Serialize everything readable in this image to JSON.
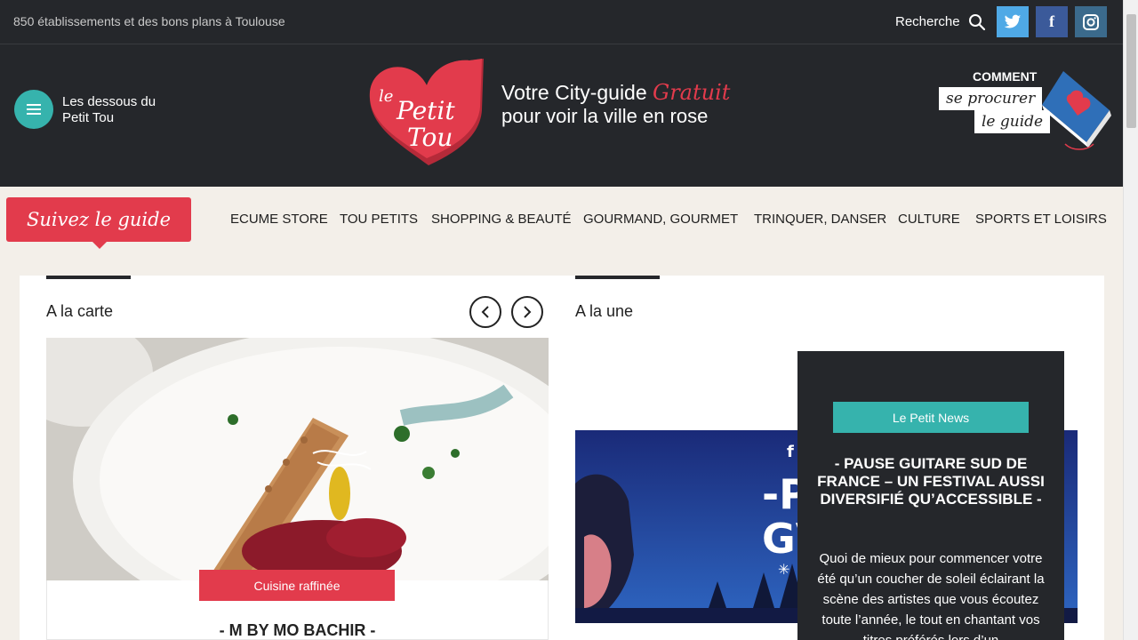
{
  "topbar": {
    "tagline": "850 établissements et des bons plans à Toulouse",
    "search_label": "Recherche",
    "social": [
      "twitter-icon",
      "facebook-icon",
      "instagram-icon"
    ]
  },
  "header": {
    "menu_label": "Les dessous du Petit Tou",
    "logo_text": [
      "le",
      "Petit",
      "Tou"
    ],
    "slogan_prefix": "Votre City-guide",
    "slogan_highlight": "Gratuit",
    "slogan_line2": "pour voir la ville en rose",
    "promo_top": "COMMENT",
    "promo_line1": "se procurer",
    "promo_line2": "le guide"
  },
  "nav": {
    "follow_label": "Suivez le guide",
    "items": [
      "ECUME STORE",
      "TOU PETITS",
      "SHOPPING & BEAUTÉ",
      "GOURMAND, GOURMET",
      "TRINQUER, DANSER",
      "CULTURE",
      "SPORTS ET LOISIRS"
    ]
  },
  "carte": {
    "title": "A la carte",
    "category": "Cuisine raffinée",
    "card_title": "- M BY MO BACHIR -"
  },
  "une": {
    "title": "A la une",
    "badge": "Le Petit News",
    "headline": "- PAUSE GUITARE SUD DE FRANCE – UN FESTIVAL AUSSI DIVERSIFIÉ QU’ACCESSIBLE -",
    "excerpt": "Quoi de mieux pour commencer votre été qu’un coucher de soleil éclairant la scène des artistes que vous écoutez toute l’année, le tout en chantant vos titres préférés lors d’un"
  },
  "colors": {
    "dark": "#25272b",
    "brand_red": "#e23b4c",
    "teal": "#36b3ad",
    "cream": "#f3efe9"
  }
}
